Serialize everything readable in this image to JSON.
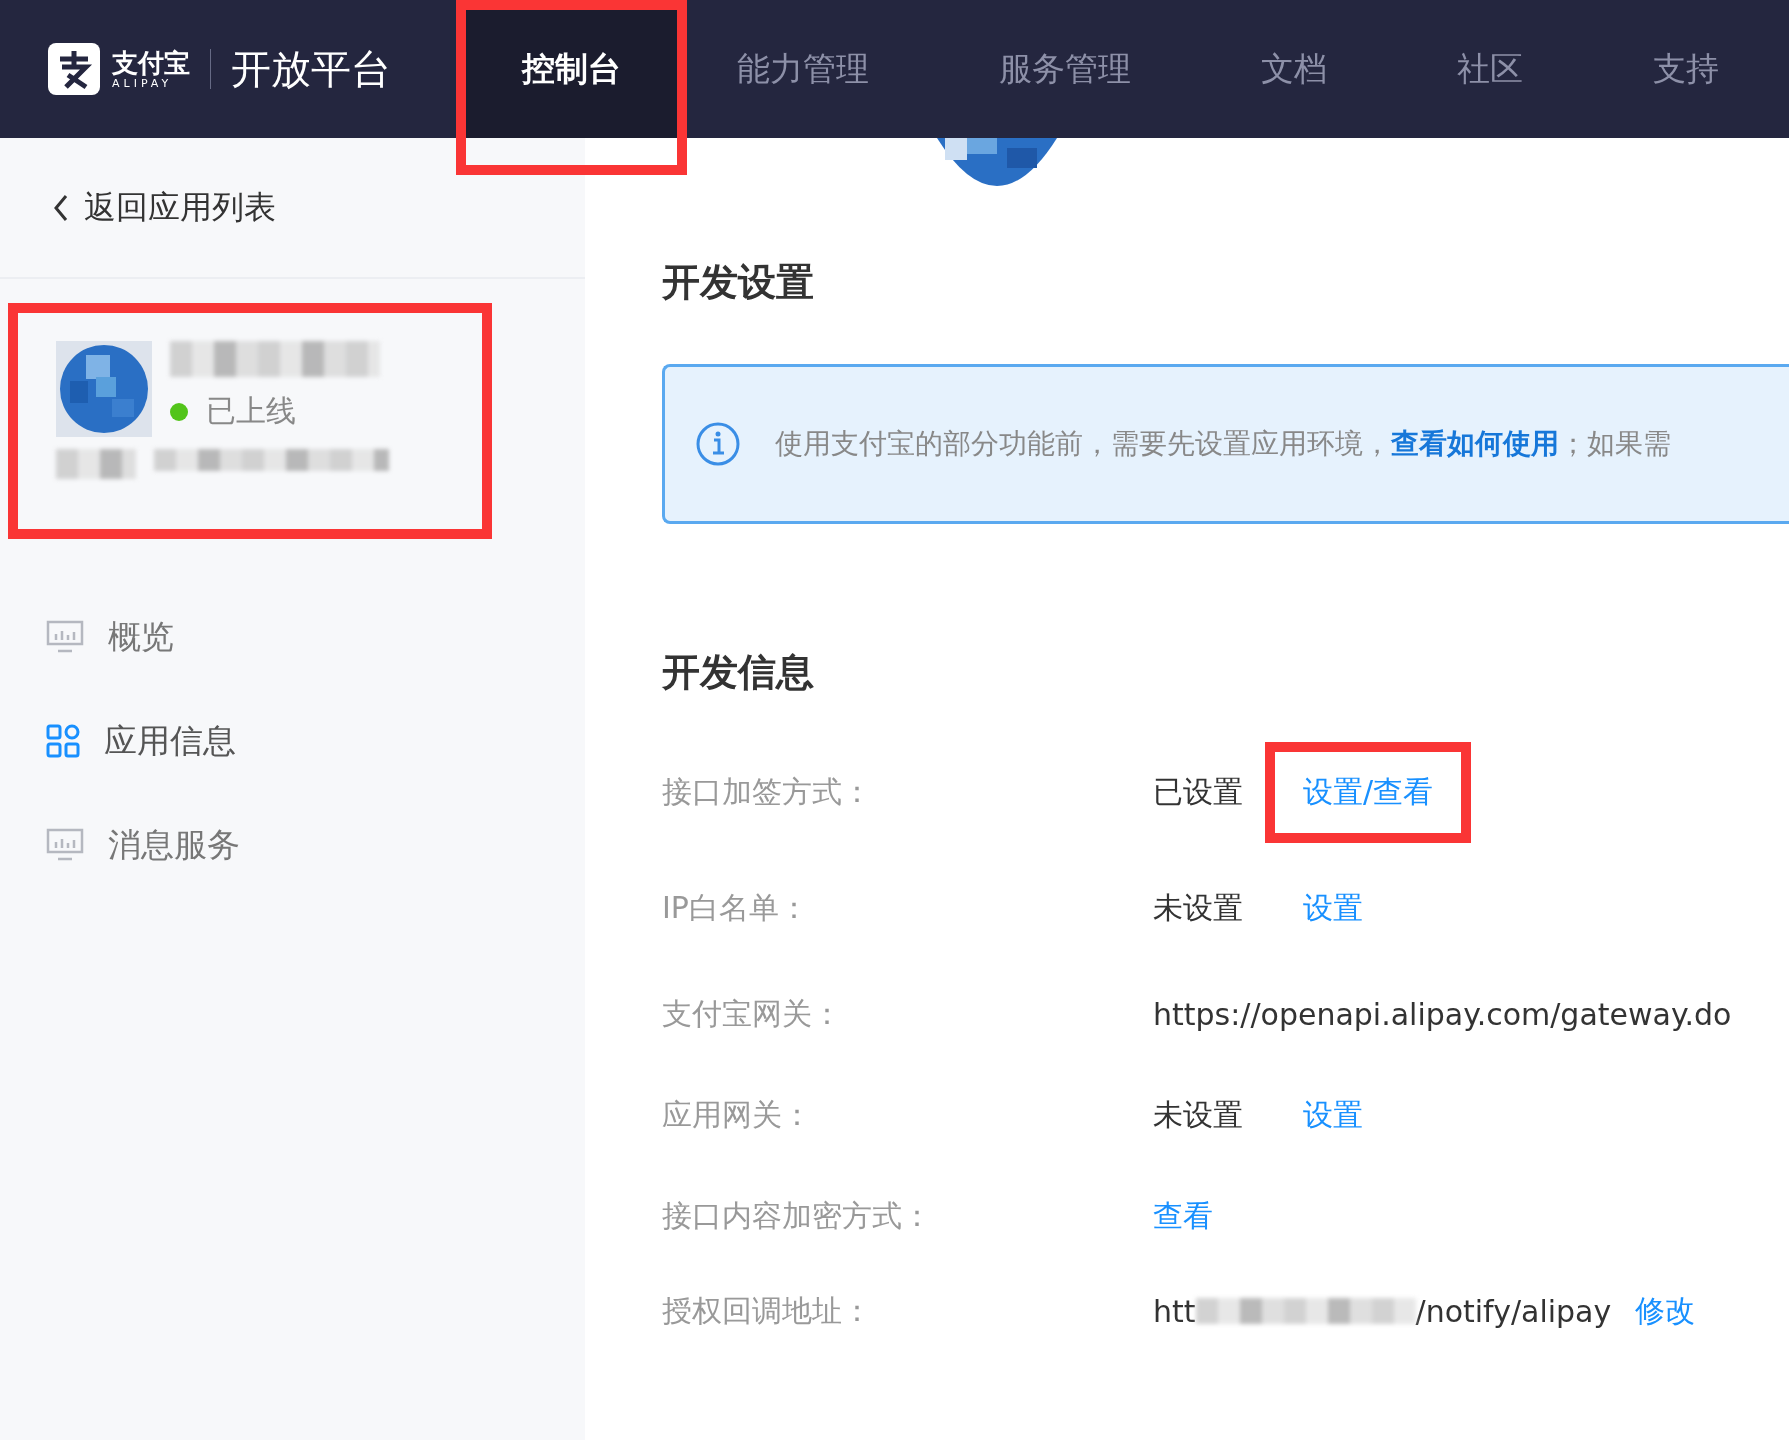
{
  "header": {
    "logo": {
      "brand": "支付宝",
      "brand_latin": "ALIPAY",
      "product": "开放平台"
    },
    "nav": [
      {
        "label": "控制台",
        "selected": true,
        "highlighted": true
      },
      {
        "label": "能力管理",
        "selected": false
      },
      {
        "label": "服务管理",
        "selected": false
      },
      {
        "label": "文档",
        "selected": false
      },
      {
        "label": "社区",
        "selected": false
      },
      {
        "label": "支持",
        "selected": false
      }
    ]
  },
  "sidebar": {
    "back_link": "返回应用列表",
    "app_card": {
      "status": "已上线",
      "highlighted": true
    },
    "menu": [
      {
        "label": "概览",
        "kind": "monitor",
        "selected": false
      },
      {
        "label": "应用信息",
        "kind": "apps",
        "selected": true
      },
      {
        "label": "消息服务",
        "kind": "monitor",
        "selected": false
      }
    ]
  },
  "sections": [
    {
      "title": "开发设置",
      "alert": {
        "text": "使用支付宝的部分功能前，需要先设置应用环境，",
        "link": "查看如何使用",
        "text_after": "；如果需"
      }
    },
    {
      "title": "开发信息",
      "rows": [
        {
          "label": "接口加签方式：",
          "value": "已设置",
          "link": "设置/查看",
          "highlighted": true
        },
        {
          "label": "IP白名单：",
          "value": "未设置",
          "link": "设置"
        },
        {
          "label": "支付宝网关：",
          "value": "https://openapi.alipay.com/gateway.do"
        },
        {
          "label": "应用网关：",
          "value": "未设置",
          "link": "设置"
        },
        {
          "label": "接口内容加密方式：",
          "link": "查看"
        },
        {
          "label": "授权回调地址：",
          "value": "htt",
          "redacted": true,
          "value_end": "/notify/alipay",
          "link": "修改"
        }
      ]
    }
  ]
}
